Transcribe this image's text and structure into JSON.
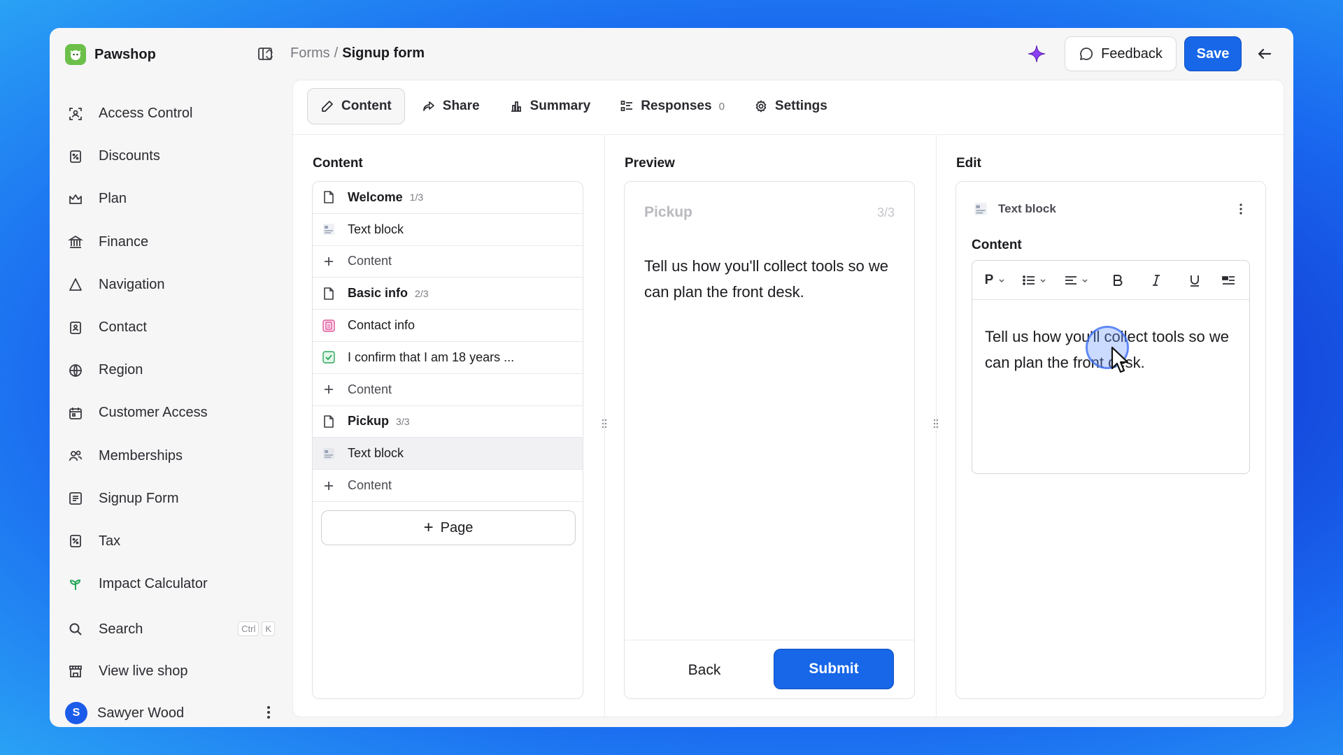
{
  "sidebar": {
    "shop_name": "Pawshop",
    "items": [
      {
        "label": "Access Control",
        "icon": "access-control-icon"
      },
      {
        "label": "Discounts",
        "icon": "discounts-icon"
      },
      {
        "label": "Plan",
        "icon": "crown-icon"
      },
      {
        "label": "Finance",
        "icon": "bank-icon"
      },
      {
        "label": "Navigation",
        "icon": "navigation-icon"
      },
      {
        "label": "Contact",
        "icon": "contact-icon"
      },
      {
        "label": "Region",
        "icon": "globe-icon"
      },
      {
        "label": "Customer Access",
        "icon": "calendar-icon"
      },
      {
        "label": "Memberships",
        "icon": "users-icon"
      },
      {
        "label": "Signup Form",
        "icon": "form-icon"
      },
      {
        "label": "Tax",
        "icon": "receipt-icon"
      },
      {
        "label": "Impact Calculator",
        "icon": "sprout-icon"
      }
    ],
    "search": {
      "label": "Search",
      "kbd1": "Ctrl",
      "kbd2": "K"
    },
    "view_live": "View live shop",
    "user": {
      "initial": "S",
      "name": "Sawyer Wood"
    }
  },
  "header": {
    "breadcrumb_parent": "Forms",
    "breadcrumb_sep": "/",
    "breadcrumb_current": "Signup form",
    "feedback_label": "Feedback",
    "save_label": "Save"
  },
  "tabs": [
    {
      "label": "Content",
      "active": true
    },
    {
      "label": "Share"
    },
    {
      "label": "Summary"
    },
    {
      "label": "Responses",
      "count": "0"
    },
    {
      "label": "Settings"
    }
  ],
  "content": {
    "title": "Content",
    "rows": [
      {
        "type": "page",
        "label": "Welcome",
        "num": "1/3"
      },
      {
        "type": "text",
        "label": "Text block"
      },
      {
        "type": "add",
        "label": "Content"
      },
      {
        "type": "page",
        "label": "Basic info",
        "num": "2/3"
      },
      {
        "type": "contact",
        "label": "Contact info"
      },
      {
        "type": "check",
        "label": "I confirm that I am 18 years ..."
      },
      {
        "type": "add",
        "label": "Content"
      },
      {
        "type": "page",
        "label": "Pickup",
        "num": "3/3"
      },
      {
        "type": "text",
        "label": "Text block",
        "selected": true
      },
      {
        "type": "add",
        "label": "Content"
      }
    ],
    "page_button": "Page"
  },
  "preview": {
    "title": "Preview",
    "page_title": "Pickup",
    "step": "3/3",
    "text": "Tell us how you'll collect tools so we can plan the front desk.",
    "back": "Back",
    "submit": "Submit"
  },
  "edit": {
    "title": "Edit",
    "block_label": "Text block",
    "content_label": "Content",
    "paragraph_style": "P",
    "text": "Tell us how you'll collect tools so we can plan the front desk."
  },
  "colors": {
    "accent": "#1767e8",
    "brand_logo": "#6cc04a",
    "sparkle": "#8a3ff0"
  }
}
